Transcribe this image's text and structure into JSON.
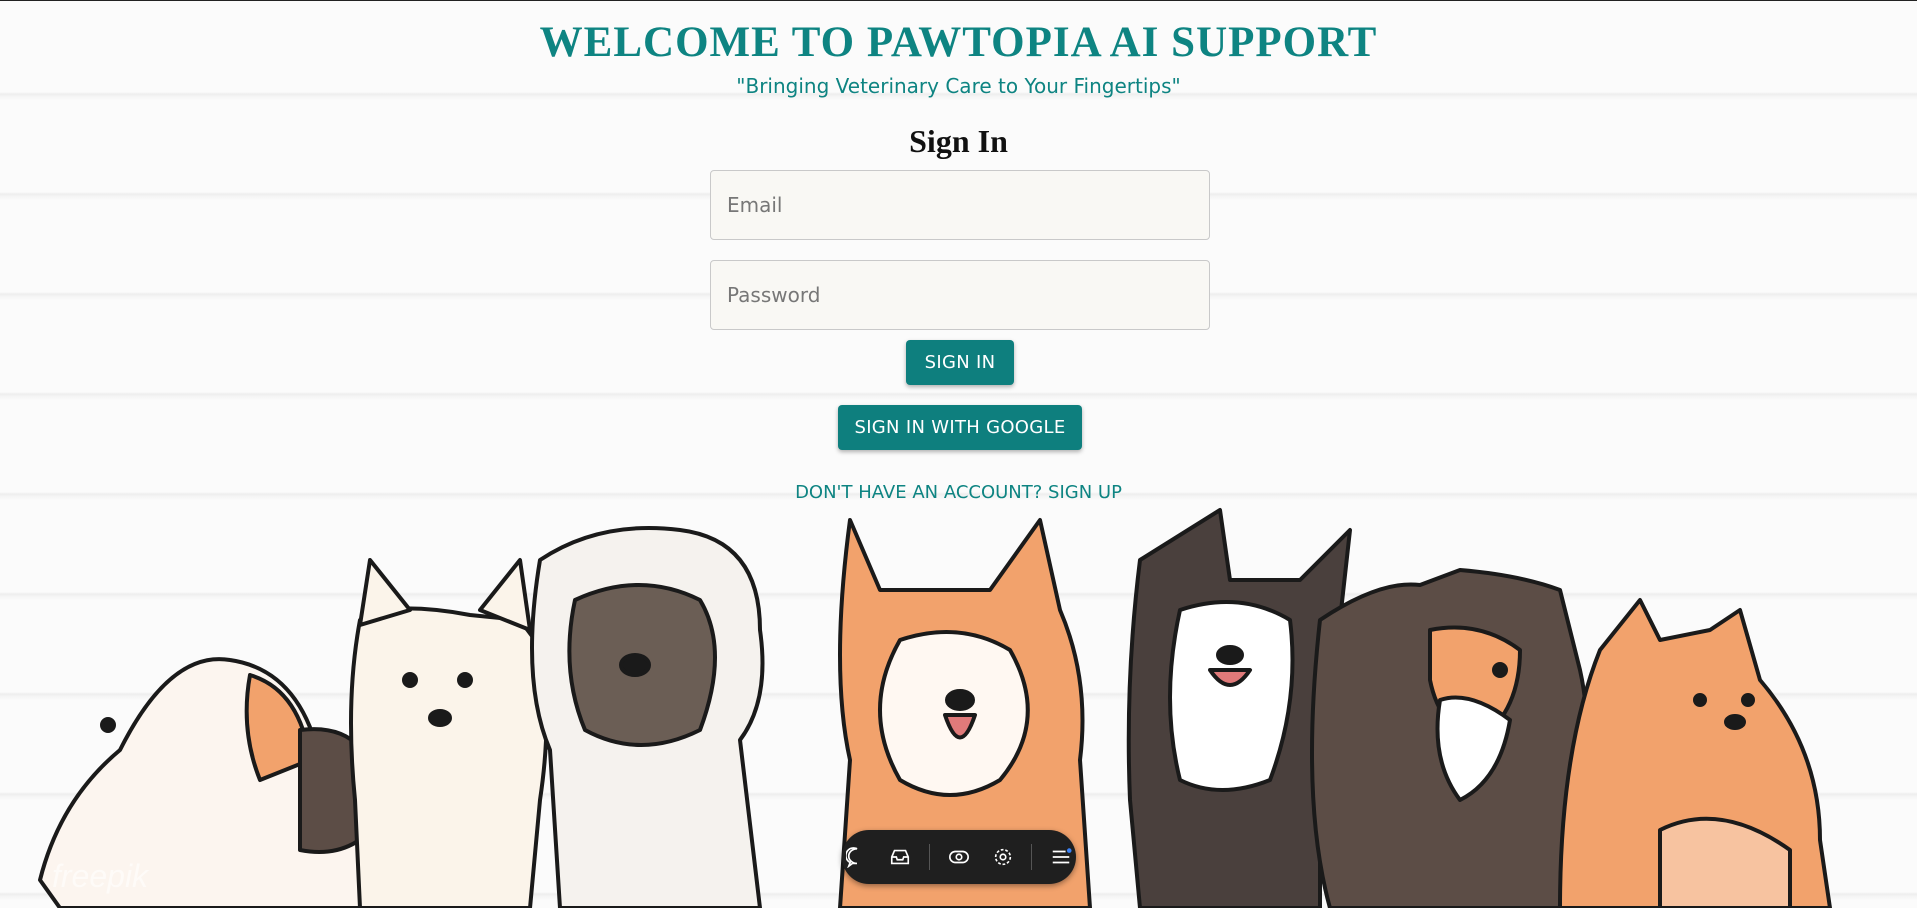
{
  "header": {
    "title": "WELCOME TO PAWTOPIA AI SUPPORT",
    "subtitle": "\"Bringing Veterinary Care to Your Fingertips\""
  },
  "form": {
    "heading": "Sign In",
    "email_placeholder": "Email",
    "email_value": "",
    "password_placeholder": "Password",
    "password_value": "",
    "signin_label": "SIGN IN",
    "google_label": "SIGN IN WITH GOOGLE",
    "signup_link": "DON'T HAVE AN ACCOUNT? SIGN UP"
  },
  "toolbar": {
    "icons": [
      "chat-icon",
      "inbox-icon",
      "eye-icon",
      "target-icon",
      "menu-icon"
    ]
  },
  "colors": {
    "accent": "#0e8482",
    "button": "#0e7f7e",
    "toolbar": "#1f1f1f"
  }
}
